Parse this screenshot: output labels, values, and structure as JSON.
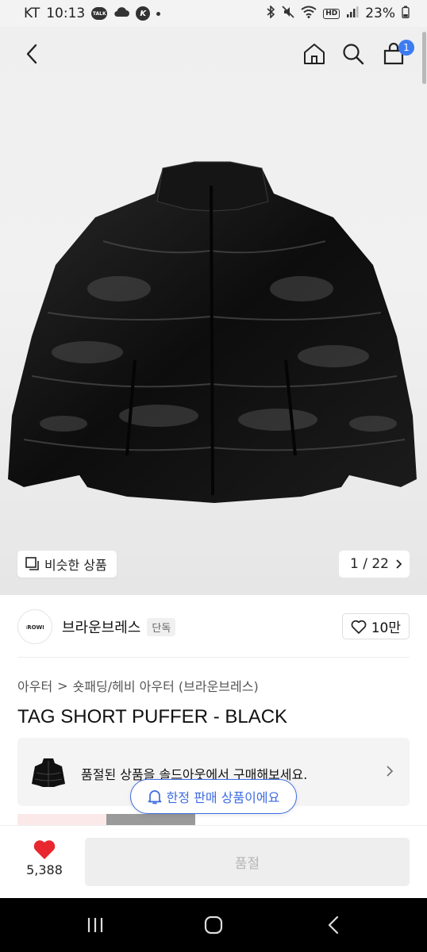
{
  "status_bar": {
    "carrier": "KT",
    "time": "10:13",
    "talk_label": "TALK",
    "k_label": "K",
    "hd_label": "HD",
    "battery_percent": "23%",
    "icons": [
      "talk-icon",
      "cloud-icon",
      "k-app-icon",
      "dot-icon",
      "bluetooth-icon",
      "mute-icon",
      "wifi-icon",
      "signal-icon",
      "battery-icon"
    ]
  },
  "top_nav": {
    "icons": [
      "back-icon",
      "home-icon",
      "search-icon",
      "cart-icon"
    ],
    "cart_badge": "1"
  },
  "hero": {
    "similar_label": "비슷한 상품",
    "page_counter": "1 / 22"
  },
  "brand": {
    "logo_text": "BROWN",
    "name": "브라운브레스",
    "exclusive_badge": "단독",
    "like_count": "10만"
  },
  "breadcrumb": {
    "category": "아우터",
    "separator": ">",
    "subcategory": "숏패딩/헤비 아우터 (브라운브레스)"
  },
  "product": {
    "title": "TAG SHORT PUFFER - BLACK"
  },
  "soldout_banner": {
    "text": "품절된 상품을 솔드아웃에서 구매해보세요."
  },
  "limited_chip": {
    "text": "한정 판매 상품이에요"
  },
  "action_bar": {
    "wish_count": "5,388",
    "soldout_button_label": "품절"
  },
  "colors": {
    "accent_blue": "#3d6be0",
    "heart_red": "#e8272f",
    "cart_badge": "#3d7bf0",
    "disabled_button_bg": "#eeeeee",
    "disabled_button_text": "#b5b5b5"
  }
}
